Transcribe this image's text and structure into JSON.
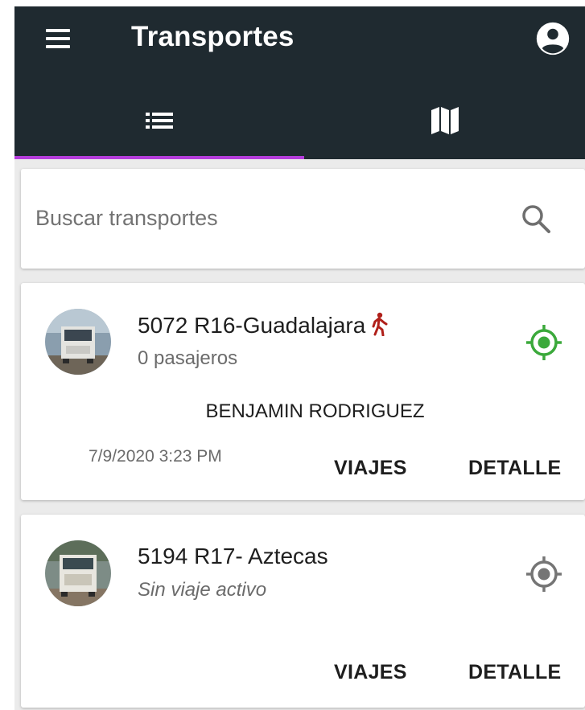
{
  "header": {
    "title": "Transportes",
    "menu_icon": "hamburger-menu-icon",
    "account_icon": "account-circle-icon"
  },
  "tabs": [
    {
      "icon": "list-icon",
      "selected": true
    },
    {
      "icon": "map-icon",
      "selected": false
    }
  ],
  "search": {
    "placeholder": "Buscar transportes",
    "value": "",
    "icon": "search-icon"
  },
  "transports": [
    {
      "name": "5072 R16-Guadalajara",
      "status": "0 pasajeros",
      "status_italic": false,
      "walking_indicator": true,
      "location_active": true,
      "driver": "BENJAMIN RODRIGUEZ",
      "timestamp": "7/9/2020 3:23 PM",
      "trips_label": "VIAJES",
      "detail_label": "DETALLE"
    },
    {
      "name": "5194 R17- Aztecas",
      "status": "Sin viaje activo",
      "status_italic": true,
      "walking_indicator": false,
      "location_active": false,
      "driver": "",
      "timestamp": "",
      "trips_label": "VIAJES",
      "detail_label": "DETALLE"
    }
  ],
  "colors": {
    "appbar": "#1f2a30",
    "tab_indicator": "#b53ddb",
    "location_active": "#3ba93b",
    "location_inactive": "#757575",
    "walking": "#b0201a",
    "background": "#ebebeb"
  }
}
